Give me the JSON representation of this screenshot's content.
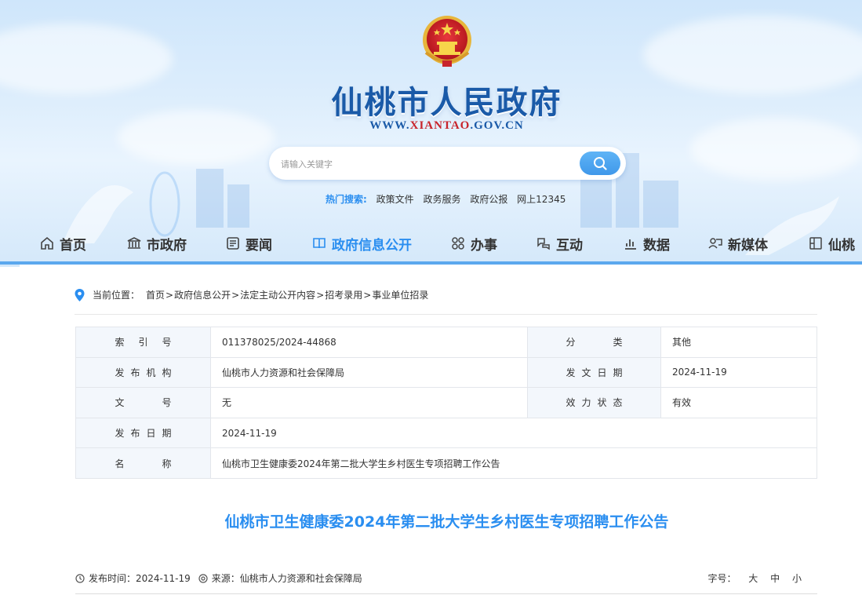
{
  "site": {
    "title": "仙桃市人民政府",
    "url_prefix": "WWW.",
    "url_red": "XIANTAO",
    "url_suffix": ".GOV.CN"
  },
  "search": {
    "placeholder": "请输入关键字",
    "hot_label": "热门搜索:",
    "hot_keywords": [
      "政策文件",
      "政务服务",
      "政府公报",
      "网上12345"
    ]
  },
  "nav": [
    {
      "label": "首页",
      "icon": "home-icon"
    },
    {
      "label": "市政府",
      "icon": "government-building-icon"
    },
    {
      "label": "要闻",
      "icon": "news-icon"
    },
    {
      "label": "政府信息公开",
      "icon": "book-icon",
      "active": true
    },
    {
      "label": "办事",
      "icon": "services-icon"
    },
    {
      "label": "互动",
      "icon": "interaction-icon"
    },
    {
      "label": "数据",
      "icon": "chart-icon"
    },
    {
      "label": "新媒体",
      "icon": "media-icon"
    },
    {
      "label": "仙桃",
      "icon": "city-icon"
    }
  ],
  "breadcrumb": {
    "prefix": "当前位置：",
    "items": [
      "首页",
      "政府信息公开",
      "法定主动公开内容",
      "招考录用",
      "事业单位招录"
    ],
    "separator": ">"
  },
  "meta_table": {
    "index_label": [
      "索",
      "引",
      "号"
    ],
    "index_value": "011378025/2024-44868",
    "category_label": [
      "分",
      "类"
    ],
    "category_value": "其他",
    "issuer_label": [
      "发",
      "布",
      "机",
      "构"
    ],
    "issuer_value": "仙桃市人力资源和社会保障局",
    "doc_date_label": [
      "发",
      "文",
      "日",
      "期"
    ],
    "doc_date_value": "2024-11-19",
    "doc_no_label": [
      "文",
      "号"
    ],
    "doc_no_value": "无",
    "status_label": [
      "效",
      "力",
      "状",
      "态"
    ],
    "status_value": "有效",
    "pub_date_label": [
      "发",
      "布",
      "日",
      "期"
    ],
    "pub_date_value": "2024-11-19",
    "name_label": [
      "名",
      "称"
    ],
    "name_value": "仙桃市卫生健康委2024年第二批大学生乡村医生专项招聘工作公告"
  },
  "article": {
    "title": "仙桃市卫生健康委2024年第二批大学生乡村医生专项招聘工作公告",
    "publish_time_label": "发布时间：",
    "publish_time": "2024-11-19",
    "source_label": "来源：",
    "source": "仙桃市人力资源和社会保障局",
    "font_size_label": "字号：",
    "font_sizes": [
      "大",
      "中",
      "小"
    ]
  },
  "colors": {
    "accent": "#2a8ef0",
    "title_blue": "#1a5aa8",
    "emblem_red": "#c8242b",
    "table_label_bg": "#f3f7fc"
  }
}
